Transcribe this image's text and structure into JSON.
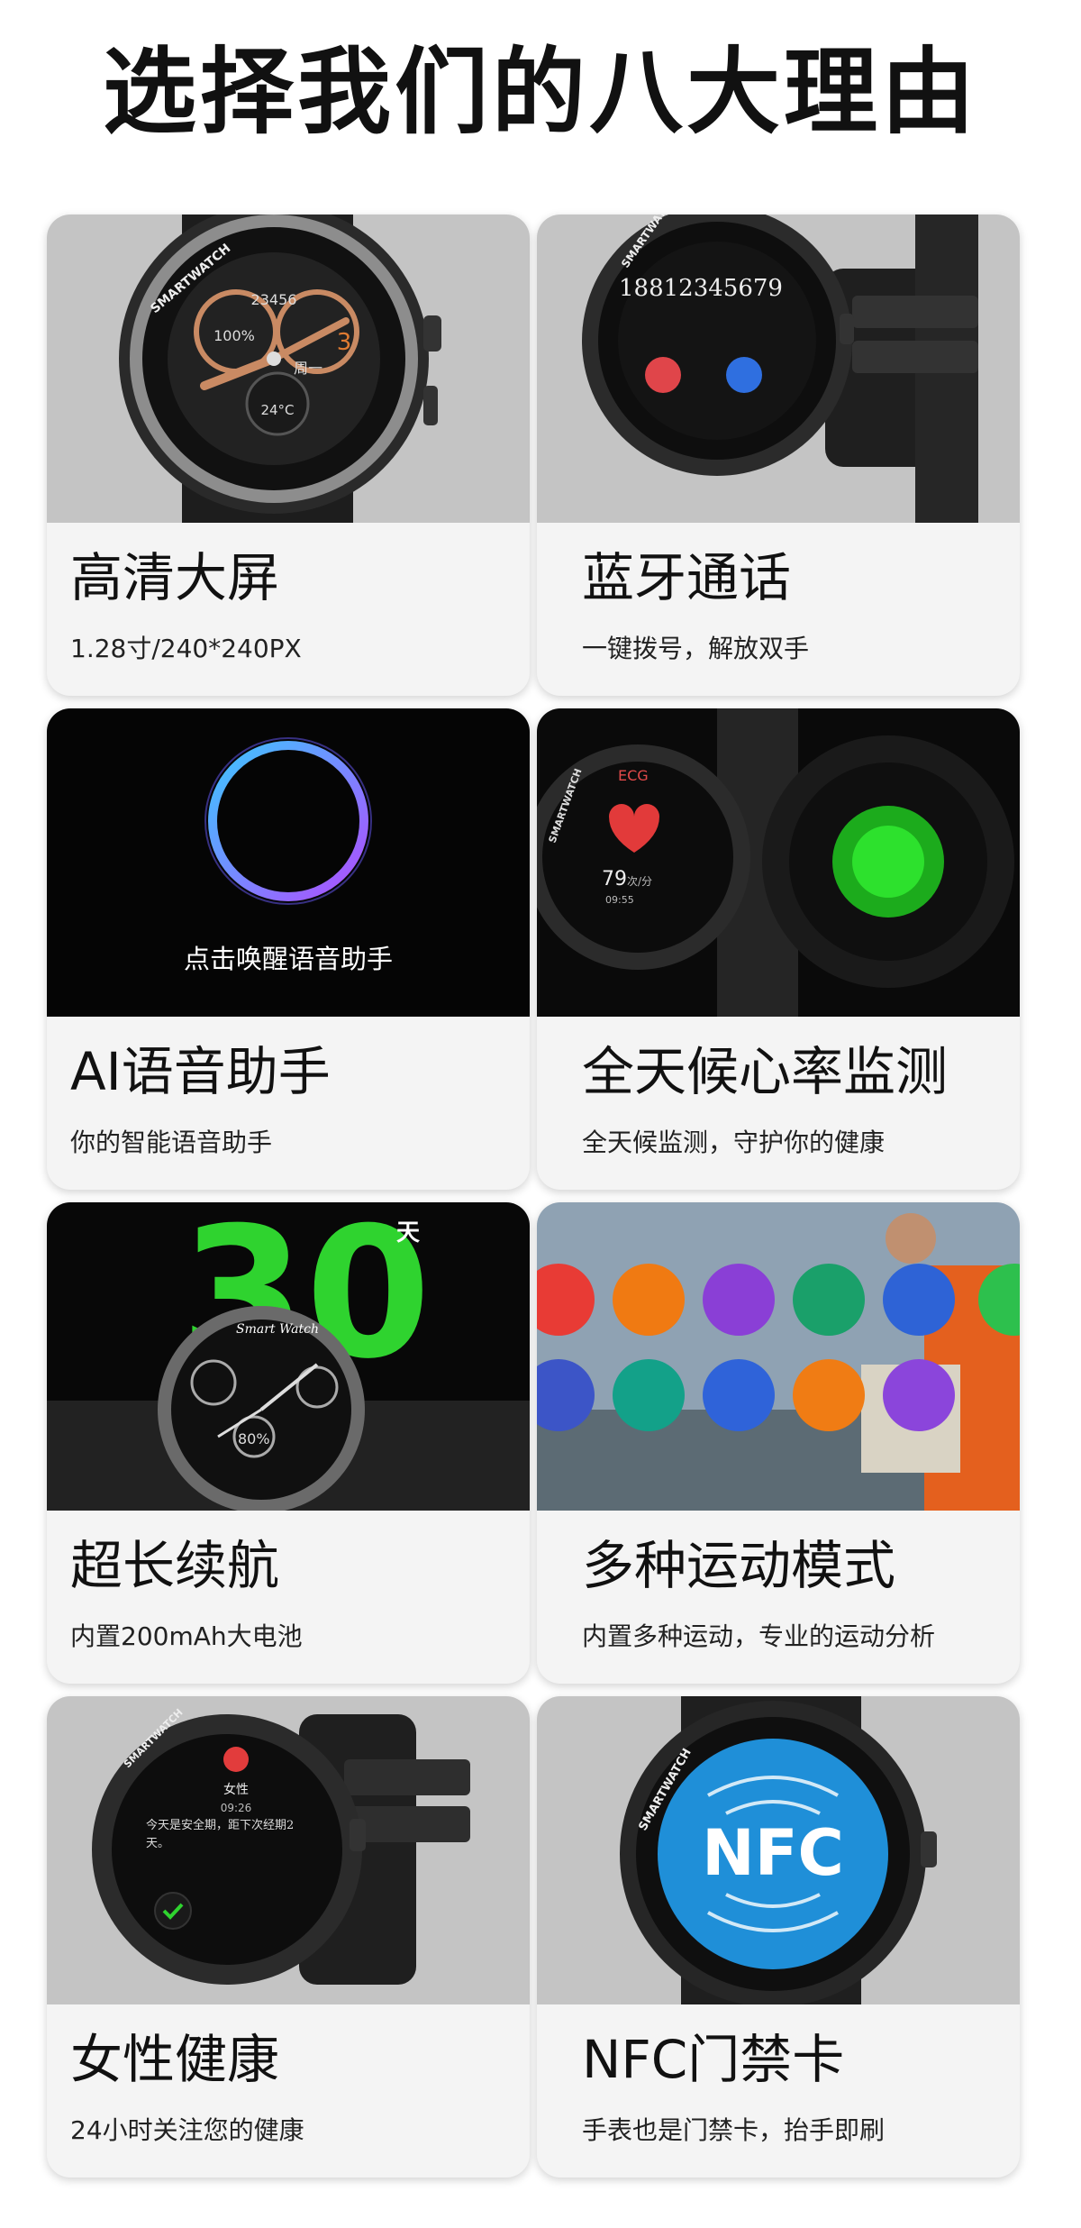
{
  "page": {
    "title": "选择我们的八大理由"
  },
  "cards": [
    {
      "title": "高清大屏",
      "subtitle": "1.28寸/240*240PX",
      "screen": {
        "steps": "23456",
        "battery": "100%",
        "day": "3",
        "weekday": "周一",
        "temp": "24°C",
        "bezel": "SMARTWATCH"
      }
    },
    {
      "title": "蓝牙通话",
      "subtitle": "一键拨号，解放双手",
      "screen": {
        "phone": "18812345679",
        "bezel": "SMARTWATCH"
      }
    },
    {
      "title": "AI语音助手",
      "subtitle": "你的智能语音助手",
      "screen": {
        "caption": "点击唤醒语音助手"
      }
    },
    {
      "title": "全天候心率监测",
      "subtitle": "全天候监测，守护你的健康",
      "screen": {
        "tag": "ECG",
        "bpm": "79",
        "unit": "次/分",
        "time": "09:55",
        "bezel": "SMARTWATCH"
      }
    },
    {
      "title": "超长续航",
      "subtitle": "内置200mAh大电池",
      "screen": {
        "days": "30",
        "unit": "天",
        "bezel": "Smart Watch",
        "battery": "80%"
      }
    },
    {
      "title": "多种运动模式",
      "subtitle": "内置多种运动，专业的运动分析",
      "screen": {
        "sports": [
          "running-icon",
          "walking-icon",
          "badminton-icon",
          "football-icon",
          "tennis-icon",
          "jogging-icon",
          "skipping-icon",
          "hiking-icon",
          "cycling-icon",
          "yoga-icon"
        ]
      }
    },
    {
      "title": "女性健康",
      "subtitle": "24小时关注您的健康",
      "screen": {
        "label": "女性",
        "time": "09:26",
        "message": "今天是安全期，距下次经期2天。",
        "bezel": "SMARTWATCH"
      }
    },
    {
      "title": "NFC门禁卡",
      "subtitle": "手表也是门禁卡，抬手即刷",
      "screen": {
        "badge": "NFC",
        "bezel": "SMARTWATCH"
      }
    }
  ],
  "colors": {
    "card_bg": "#f4f4f4",
    "photo_bg": "#c5c5c5",
    "accent_green": "#2fd32f",
    "nfc_blue": "#1f8fd8"
  }
}
